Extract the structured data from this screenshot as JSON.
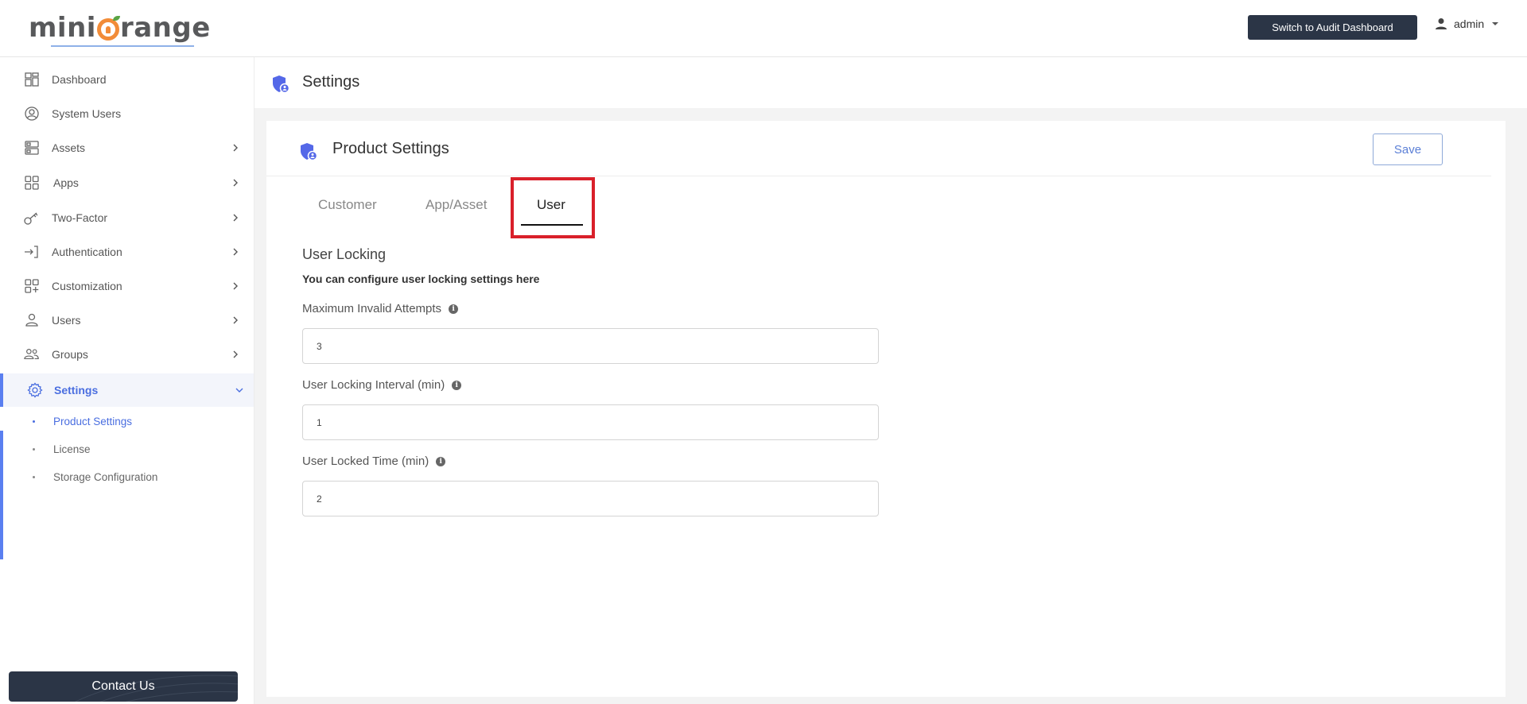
{
  "header": {
    "logo_text_pre": "mini",
    "logo_text_post": "range",
    "audit_button": "Switch to Audit Dashboard",
    "user_name": "admin"
  },
  "sidebar": {
    "items": [
      {
        "label": "Dashboard",
        "icon": "dashboard-icon",
        "has_chevron": false
      },
      {
        "label": "System Users",
        "icon": "user-circle-icon",
        "has_chevron": false
      },
      {
        "label": "Assets",
        "icon": "assets-icon",
        "has_chevron": true
      },
      {
        "label": "Apps",
        "icon": "apps-grid-icon",
        "has_chevron": true
      },
      {
        "label": "Two-Factor",
        "icon": "key-icon",
        "has_chevron": true
      },
      {
        "label": "Authentication",
        "icon": "login-icon",
        "has_chevron": true
      },
      {
        "label": "Customization",
        "icon": "customization-icon",
        "has_chevron": true
      },
      {
        "label": "Users",
        "icon": "user-icon",
        "has_chevron": true
      },
      {
        "label": "Groups",
        "icon": "groups-icon",
        "has_chevron": true
      },
      {
        "label": "Settings",
        "icon": "gear-icon",
        "has_chevron": true,
        "expanded": true,
        "active": true
      }
    ],
    "submenu": [
      {
        "label": "Product Settings",
        "active": true
      },
      {
        "label": "License",
        "active": false
      },
      {
        "label": "Storage Configuration",
        "active": false
      }
    ],
    "contact_button": "Contact Us"
  },
  "page": {
    "title": "Settings"
  },
  "card": {
    "title": "Product Settings",
    "save_label": "Save",
    "tabs": [
      {
        "label": "Customer",
        "active": false
      },
      {
        "label": "App/Asset",
        "active": false
      },
      {
        "label": "User",
        "active": true
      }
    ],
    "section": {
      "title": "User Locking",
      "description": "You can configure user locking settings here",
      "fields": [
        {
          "label": "Maximum Invalid Attempts",
          "value": "3"
        },
        {
          "label": "User Locking Interval (min)",
          "value": "1"
        },
        {
          "label": "User Locked Time (min)",
          "value": "2"
        }
      ]
    }
  },
  "colors": {
    "accent": "#4a6ee0",
    "dark_button": "#2b3546",
    "highlight": "#d9202a",
    "logo_orange": "#f28c38"
  }
}
